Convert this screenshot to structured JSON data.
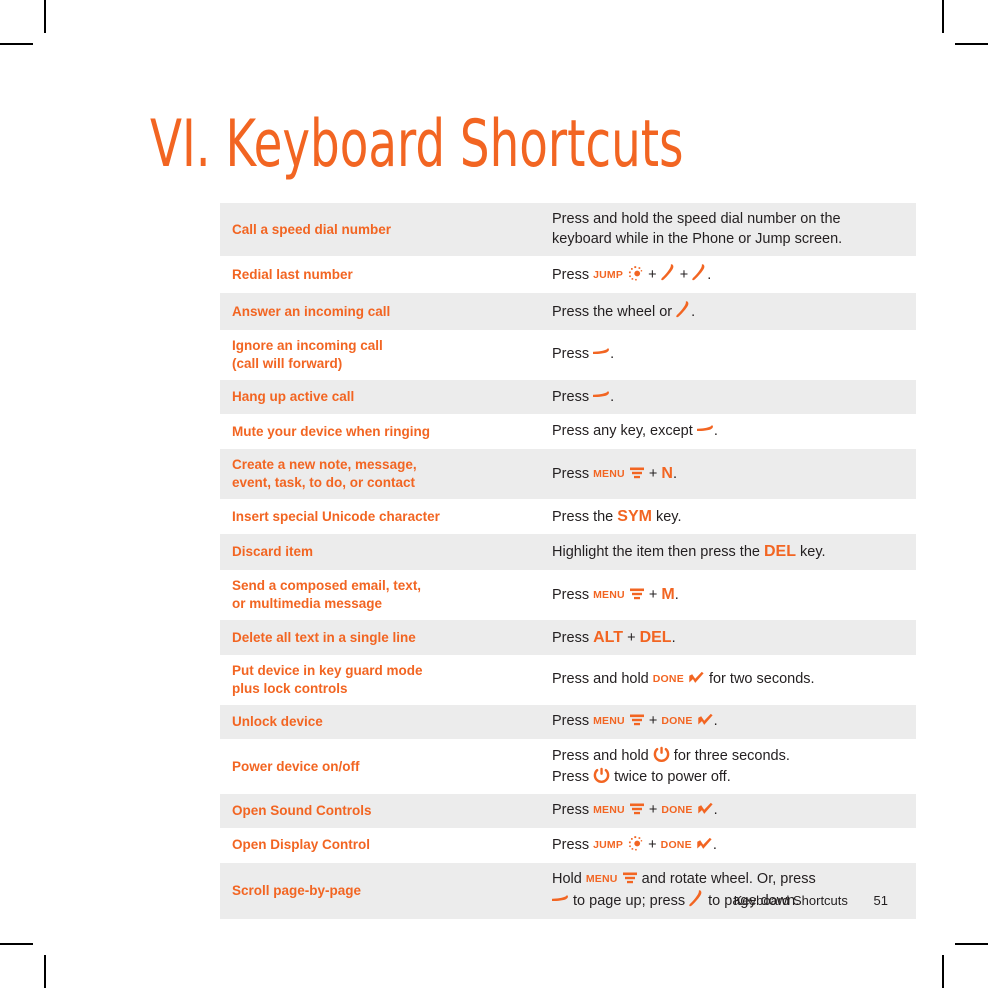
{
  "page": {
    "title": "VI. Keyboard Shortcuts",
    "accent_color": "#f26522",
    "text_color": "#231f20",
    "row_shade_color": "#ececec"
  },
  "footer": {
    "section": "Keyboard Shortcuts",
    "page_number": "51"
  },
  "icons": {
    "jump": "jump-dots-icon",
    "menu": "menu-bars-icon",
    "done": "done-check-icon",
    "power": "power-icon",
    "call": "call-send-icon",
    "endcall": "call-end-icon"
  },
  "table": {
    "rows": [
      {
        "action": "Call a speed dial number",
        "action_line2": "",
        "desc": "Press and hold the speed dial number on the keyboard while in the Phone or Jump screen."
      },
      {
        "action": "Redial last number",
        "action_line2": "",
        "desc": "Press JUMP + + ."
      },
      {
        "action": "Answer an incoming call",
        "action_line2": "",
        "desc": "Press the wheel or ."
      },
      {
        "action": "Ignore an incoming call",
        "action_line2": "(call will forward)",
        "desc": "Press ."
      },
      {
        "action": "Hang up active call",
        "action_line2": "",
        "desc": "Press ."
      },
      {
        "action": "Mute your device when ringing",
        "action_line2": "",
        "desc": "Press any key, except ."
      },
      {
        "action": "Create a new note, message,",
        "action_line2": "event, task, to do, or contact",
        "desc": "Press MENU + N."
      },
      {
        "action": "Insert special Unicode character",
        "action_line2": "",
        "desc": "Press the SYM key."
      },
      {
        "action": "Discard item",
        "action_line2": "",
        "desc": "Highlight the item then press the DEL key."
      },
      {
        "action": "Send a composed email, text,",
        "action_line2": "or multimedia message",
        "desc": "Press MENU + M."
      },
      {
        "action": "Delete all text in a single line",
        "action_line2": "",
        "desc": "Press ALT + DEL."
      },
      {
        "action": "Put device in key guard mode",
        "action_line2": "plus lock controls",
        "desc": "Press and hold DONE for two seconds."
      },
      {
        "action": "Unlock device",
        "action_line2": "",
        "desc": "Press MENU + DONE ."
      },
      {
        "action": "Power device on/off",
        "action_line2": "",
        "desc": "Press and hold for three seconds. Press twice to power off."
      },
      {
        "action": "Open Sound Controls",
        "action_line2": "",
        "desc": "Press MENU + DONE ."
      },
      {
        "action": "Open Display Control",
        "action_line2": "",
        "desc": "Press JUMP + DONE ."
      },
      {
        "action": "Scroll page-by-page",
        "action_line2": "",
        "desc": "Hold MENU and rotate wheel. Or, press to page up; press to page down."
      }
    ],
    "labels": {
      "jump": "JUMP",
      "menu": "MENU",
      "done": "DONE",
      "sym": "SYM",
      "del": "DEL",
      "alt": "ALT",
      "n": "N",
      "m": "M",
      "press": "Press",
      "press_and_hold": "Press and hold",
      "hold": "Hold",
      "plus": "+",
      "period": ".",
      "speed_dial_l1": "Press and hold the speed dial number on the",
      "speed_dial_l2": "keyboard while in the Phone or Jump screen.",
      "press_the_wheel_or": "Press the wheel or",
      "press_any_key_except": "Press any key, except",
      "press_the": "Press the",
      "key_word": "key.",
      "highlight_item": "Highlight the item then press the",
      "for_two_seconds": "for two seconds.",
      "for_three_seconds": "for three seconds.",
      "twice_to_power_off": "twice to power off.",
      "and_rotate_wheel": "and rotate wheel. Or, press",
      "to_page_up": "to page up; press",
      "to_page_down": "to page down."
    }
  }
}
